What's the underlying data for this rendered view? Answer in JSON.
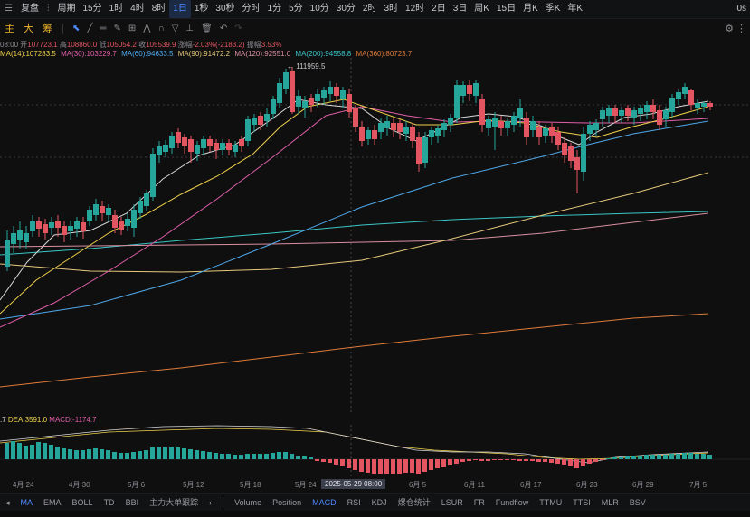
{
  "toolbar": {
    "items": [
      "复盘",
      "周期",
      "15分",
      "1时",
      "4时",
      "8时",
      "1日",
      "1秒",
      "30秒",
      "分时",
      "1分",
      "5分",
      "10分",
      "30分",
      "2时",
      "3时",
      "12时",
      "2日",
      "3日",
      "周K",
      "15日",
      "月K",
      "季K",
      "年K"
    ],
    "active_index": 6,
    "right_label": "0s"
  },
  "drawbar": {
    "items": [
      "主",
      "大",
      "筹"
    ]
  },
  "ohlc": {
    "time": "08:00",
    "open_label": "开",
    "open": "107723.1",
    "high_label": "高",
    "high": "108860.0",
    "low_label": "低",
    "low": "105054.2",
    "close_label": "收",
    "close": "105539.9",
    "change_label": "涨幅",
    "change": "-2.03%(-2183.2)",
    "amp_label": "振幅",
    "amp": "3.53%"
  },
  "ma_legend": [
    {
      "label": "MA(14):107283.5",
      "color": "#f0d24a"
    },
    {
      "label": "MA(30):103229.7",
      "color": "#e05ea8"
    },
    {
      "label": "MA(60):94633.5",
      "color": "#4fa8e8"
    },
    {
      "label": "MA(90):91472.2",
      "color": "#e6c97a"
    },
    {
      "label": "MA(120):92551.0",
      "color": "#d98fa0"
    },
    {
      "label": "MA(200):94558.8",
      "color": "#3cc6c6"
    },
    {
      "label": "MA(360):80723.7",
      "color": "#e07b39"
    }
  ],
  "macd_legend": {
    "dif": ".7",
    "dea": "DEA:3591.0",
    "macd": "MACD:-1174.7"
  },
  "peak_label": "← 111959.5",
  "crosshair_label": "2025-05-29 08:00",
  "x_labels": [
    "4月 24",
    "4月 30",
    "5月 6",
    "5月 12",
    "5月 18",
    "5月 24",
    "6月 5",
    "6月 11",
    "6月 17",
    "6月 23",
    "6月 29",
    "7月 5"
  ],
  "bottombar": {
    "left_items": [
      "MA",
      "EMA",
      "BOLL",
      "TD",
      "BBI",
      "主力大单跟踪"
    ],
    "right_items": [
      "Volume",
      "Position",
      "MACD",
      "RSI",
      "KDJ",
      "爆仓统计",
      "LSUR",
      "FR",
      "Fundflow",
      "TTMU",
      "TTSI",
      "MLR",
      "BSV"
    ],
    "active_left": "MA",
    "active_right": "MACD"
  },
  "colors": {
    "up": "#26a69a",
    "down": "#e35561",
    "accent": "#4f8cff"
  }
}
